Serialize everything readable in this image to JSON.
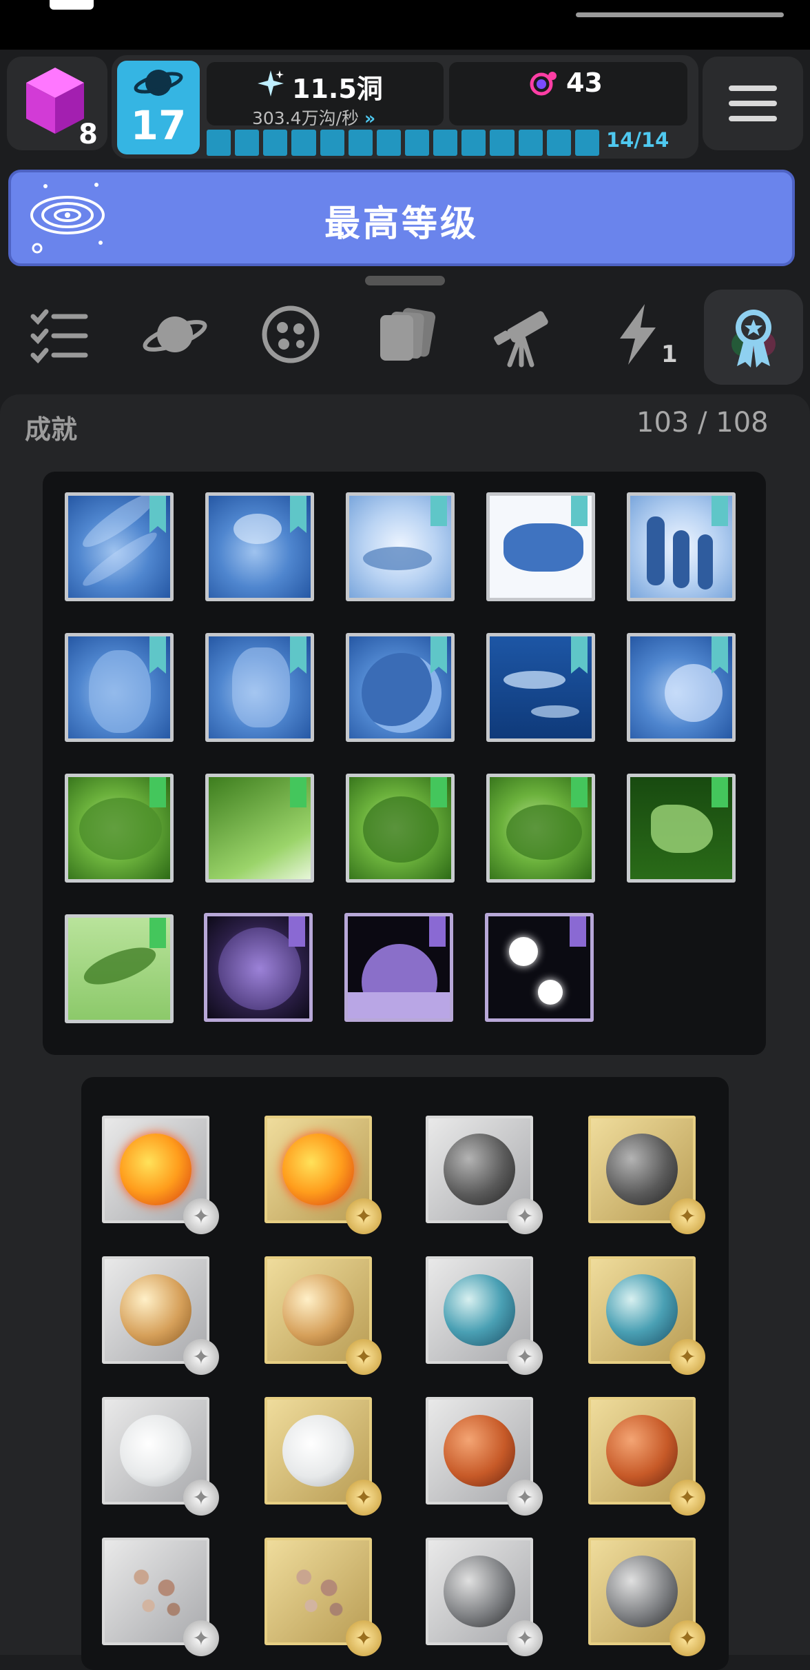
{
  "header": {
    "cube_count": "8",
    "level": "17",
    "currency_value": "11.5洞",
    "currency_rate": "303.4万沟/秒",
    "gem_value": "43",
    "progress_text": "14/14",
    "progress_fraction": 1.0
  },
  "banner": {
    "label": "最高等级"
  },
  "tabs": {
    "items": [
      "checklist-icon",
      "planet-icon",
      "cells-icon",
      "cards-icon",
      "telescope-icon",
      "lightning-icon",
      "award-ribbon-icon"
    ],
    "selected": "award-ribbon-icon",
    "bolt_badge": "1"
  },
  "achievements": {
    "title": "成就",
    "count": "103 / 108"
  },
  "colors": {
    "level_blue": "#35b5e3",
    "banner_blue": "#6a84ec",
    "progress_cyan": "#2296c0",
    "progress_text": "#4fc8ef",
    "flag_teal": "#5fc6c8",
    "flag_green": "#44c65c",
    "flag_purple": "#8a69d3"
  }
}
